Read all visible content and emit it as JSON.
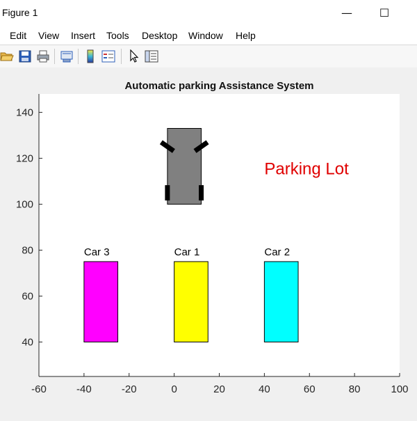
{
  "window": {
    "title": "Figure 1",
    "minimize_label": "—",
    "maximize_label": "☐"
  },
  "menu": {
    "items": [
      "Edit",
      "View",
      "Insert",
      "Tools",
      "Desktop",
      "Window",
      "Help"
    ]
  },
  "toolbar": {
    "icons": [
      "open-folder-icon",
      "save-icon",
      "print-icon",
      "print-preview-icon",
      "colorbar-icon",
      "legend-icon",
      "pointer-icon",
      "property-inspector-icon"
    ]
  },
  "chart_data": {
    "type": "scatter",
    "title": "Automatic parking Assistance System",
    "xlabel": "",
    "ylabel": "",
    "xlim": [
      -60,
      100
    ],
    "ylim": [
      25,
      148
    ],
    "xticks": [
      -60,
      -40,
      -20,
      0,
      20,
      40,
      60,
      80,
      100
    ],
    "yticks": [
      40,
      60,
      80,
      100,
      120,
      140
    ],
    "grid": false,
    "annotation": {
      "text": "Parking Lot",
      "x": 40,
      "y": 113,
      "color": "#e00000"
    },
    "parked_cars": [
      {
        "label": "Car 3",
        "x": -40,
        "y": 40,
        "width": 15,
        "height": 35,
        "color": "#ff00ff"
      },
      {
        "label": "Car 1",
        "x": 0,
        "y": 40,
        "width": 15,
        "height": 35,
        "color": "#ffff00"
      },
      {
        "label": "Car 2",
        "x": 40,
        "y": 40,
        "width": 15,
        "height": 35,
        "color": "#00ffff"
      }
    ],
    "moving_car": {
      "x": -3,
      "y": 100,
      "width": 15,
      "height": 33,
      "color": "#808080"
    }
  }
}
